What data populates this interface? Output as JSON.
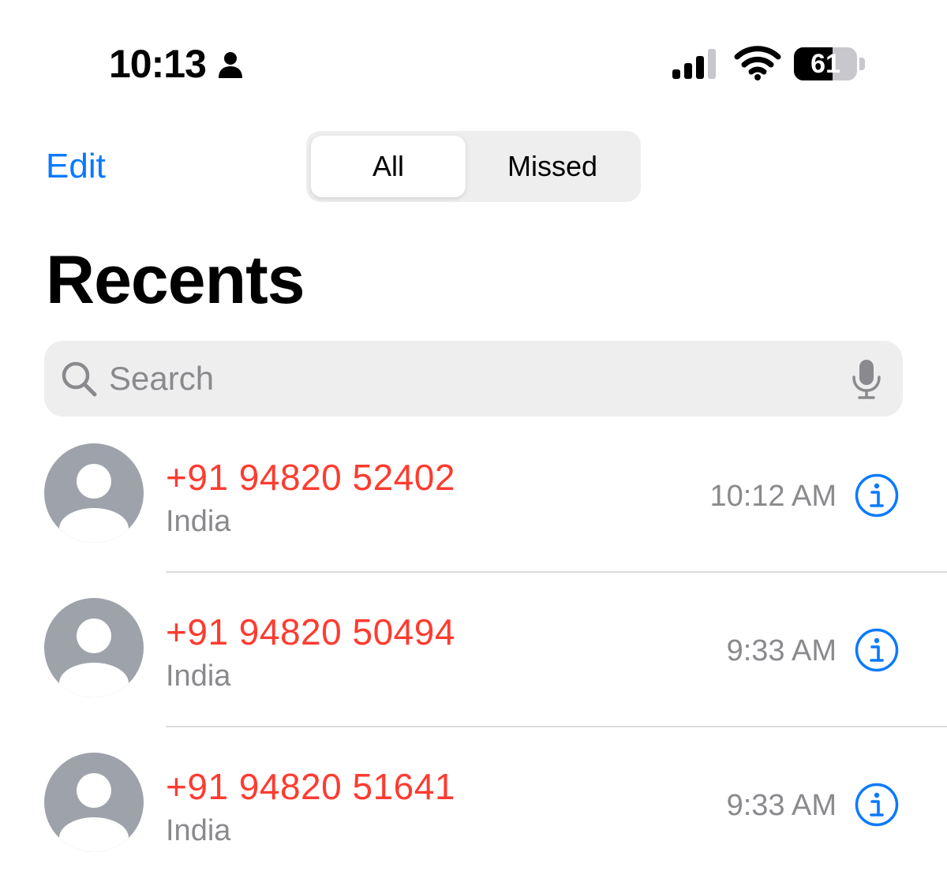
{
  "status_bar": {
    "time": "10:13",
    "battery_level": "61",
    "battery_fraction": 0.61,
    "icons": [
      "person-icon",
      "cellular-signal-icon",
      "wifi-icon",
      "battery-icon"
    ]
  },
  "nav": {
    "edit_label": "Edit",
    "segments": [
      {
        "label": "All",
        "selected": true
      },
      {
        "label": "Missed",
        "selected": false
      }
    ]
  },
  "page": {
    "title": "Recents"
  },
  "search": {
    "placeholder": "Search",
    "value": "",
    "icons": [
      "search-icon",
      "microphone-icon"
    ]
  },
  "calls": [
    {
      "number": "+91 94820 52402",
      "location": "India",
      "time": "10:12 AM"
    },
    {
      "number": "+91 94820 50494",
      "location": "India",
      "time": "9:33 AM"
    },
    {
      "number": "+91 94820 51641",
      "location": "India",
      "time": "9:33 AM"
    }
  ],
  "colors": {
    "accent": "#0a7aff",
    "missed": "#ff3b30",
    "secondary_text": "#8a8a8e",
    "avatar": "#9ea2ab"
  }
}
